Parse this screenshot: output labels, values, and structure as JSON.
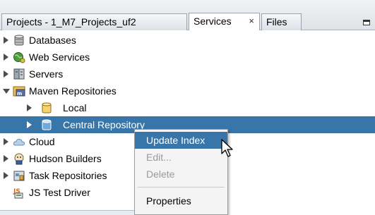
{
  "tabs": [
    {
      "label": "Projects - 1_M7_Projects_uf2",
      "active": false
    },
    {
      "label": "Services",
      "active": true,
      "close": "×"
    },
    {
      "label": "Files",
      "active": false
    }
  ],
  "tree": [
    {
      "label": "Databases",
      "icon": "database-icon",
      "expanded": false,
      "selected": false
    },
    {
      "label": "Web Services",
      "icon": "web-services-globe-icon",
      "expanded": false,
      "selected": false
    },
    {
      "label": "Servers",
      "icon": "server-icon",
      "expanded": false,
      "selected": false
    },
    {
      "label": "Maven Repositories",
      "icon": "maven-repository-icon",
      "expanded": true,
      "selected": false
    },
    {
      "label": "Local",
      "icon": "local-repository-cylinder-icon",
      "expanded": false,
      "selected": false
    },
    {
      "label": "Central Repository",
      "icon": "central-repository-cylinder-icon",
      "expanded": false,
      "selected": true
    },
    {
      "label": "Cloud",
      "icon": "cloud-icon",
      "expanded": false,
      "selected": false
    },
    {
      "label": "Hudson Builders",
      "icon": "hudson-builders-icon",
      "expanded": false,
      "selected": false
    },
    {
      "label": "Task Repositories",
      "icon": "task-repositories-icon",
      "expanded": false,
      "selected": false
    },
    {
      "label": "JS Test Driver",
      "icon": "js-test-driver-icon",
      "expanded": false,
      "selected": false
    }
  ],
  "context_menu": {
    "items": [
      {
        "label": "Update Index",
        "state": "highlighted"
      },
      {
        "label": "Edit...",
        "state": "disabled"
      },
      {
        "label": "Delete",
        "state": "disabled"
      },
      {
        "label": "Properties",
        "state": "enabled"
      }
    ]
  },
  "colors": {
    "selection": "#3875a8",
    "menu_background": "#f4f4f4",
    "disabled_text": "#9a9a9a"
  }
}
